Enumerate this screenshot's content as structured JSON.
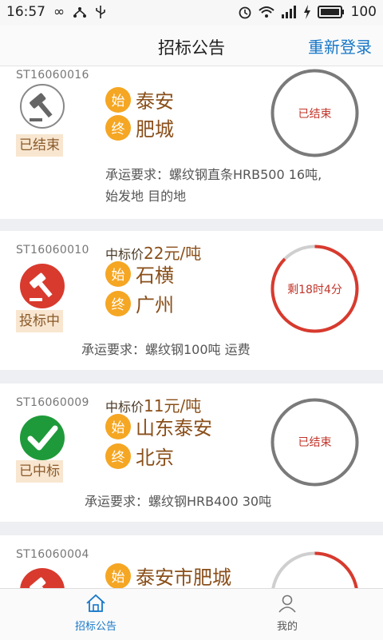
{
  "status_bar": {
    "time": "16:57",
    "battery": "100"
  },
  "header": {
    "title": "招标公告",
    "action": "重新登录"
  },
  "cards": [
    {
      "id": "ST16060016",
      "tag": "已结束",
      "origin": "泰安",
      "dest": "肥城",
      "ring": "已结束",
      "req_line1": "承运要求：螺纹钢直条HRB500 16吨,",
      "req_line2": "始发地 目的地"
    },
    {
      "id": "ST16060010",
      "price_label": "中标价",
      "price_value": "22元/吨",
      "tag": "投标中",
      "origin": "石横",
      "dest": "广州",
      "ring": "剩18时4分",
      "req_line1": "承运要求：螺纹钢100吨 运费"
    },
    {
      "id": "ST16060009",
      "price_label": "中标价",
      "price_value": "11元/吨",
      "tag": "已中标",
      "origin": "山东泰安",
      "dest": "北京",
      "ring": "已结束",
      "req_line1": "承运要求：螺纹钢HRB400 30吨"
    },
    {
      "id": "ST16060004",
      "origin": "泰安市肥城"
    }
  ],
  "route_badges": {
    "origin": "始",
    "dest": "终"
  },
  "tabs": [
    {
      "label": "招标公告",
      "active": true
    },
    {
      "label": "我的",
      "active": false
    }
  ],
  "colors": {
    "accent": "#1677c8",
    "route_badge": "#f5a623",
    "city_text": "#8a4f1a",
    "ring_active": "#d83a2e",
    "ring_ended": "#7a7a7a",
    "won": "#1f9a3a"
  }
}
